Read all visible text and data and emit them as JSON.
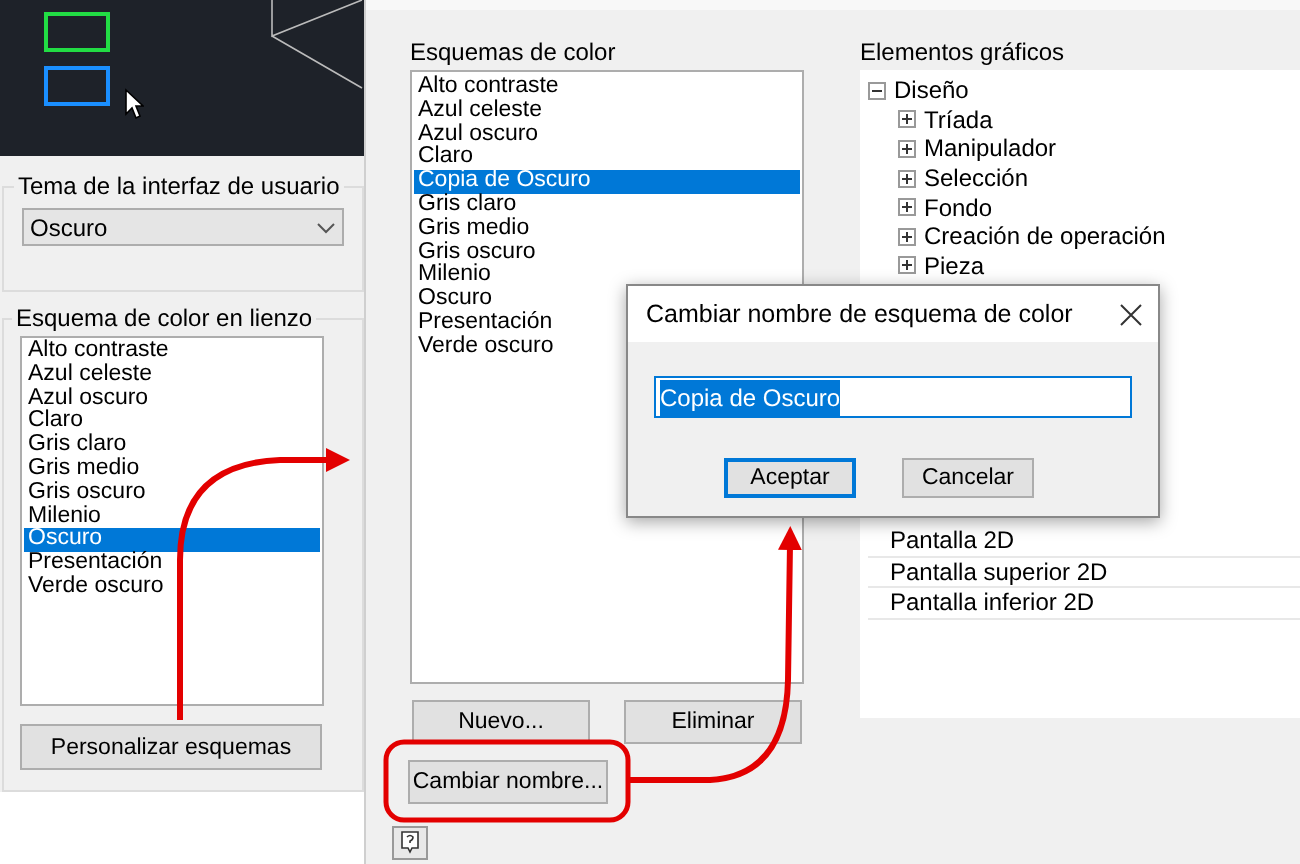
{
  "ui_theme": {
    "label": "Tema de la interfaz de usuario",
    "value": "Oscuro"
  },
  "canvas_scheme": {
    "label": "Esquema de color en lienzo",
    "items": [
      {
        "label": "Alto contraste",
        "selected": false
      },
      {
        "label": "Azul celeste",
        "selected": false
      },
      {
        "label": "Azul oscuro",
        "selected": false
      },
      {
        "label": "Claro",
        "selected": false
      },
      {
        "label": "Gris claro",
        "selected": false
      },
      {
        "label": "Gris medio",
        "selected": false
      },
      {
        "label": "Gris oscuro",
        "selected": false
      },
      {
        "label": "Milenio",
        "selected": false
      },
      {
        "label": "Oscuro",
        "selected": true
      },
      {
        "label": "Presentación",
        "selected": false
      },
      {
        "label": "Verde oscuro",
        "selected": false
      }
    ],
    "button": "Personalizar esquemas"
  },
  "schemes": {
    "label": "Esquemas de color",
    "items": [
      {
        "label": "Alto contraste",
        "selected": false
      },
      {
        "label": "Azul celeste",
        "selected": false
      },
      {
        "label": "Azul oscuro",
        "selected": false
      },
      {
        "label": "Claro",
        "selected": false
      },
      {
        "label": "Copia de Oscuro",
        "selected": true
      },
      {
        "label": "Gris claro",
        "selected": false
      },
      {
        "label": "Gris medio",
        "selected": false
      },
      {
        "label": "Gris oscuro",
        "selected": false
      },
      {
        "label": "Milenio",
        "selected": false
      },
      {
        "label": "Oscuro",
        "selected": false
      },
      {
        "label": "Presentación",
        "selected": false
      },
      {
        "label": "Verde oscuro",
        "selected": false
      }
    ],
    "buttons": [
      "Nuevo...",
      "Eliminar"
    ],
    "rename_button": "Cambiar nombre..."
  },
  "graphics": {
    "label": "Elementos gráficos",
    "tree": [
      {
        "label": "Diseño",
        "expanded": true,
        "children": [
          {
            "label": "Tríada",
            "expanded": false
          },
          {
            "label": "Manipulador",
            "expanded": false
          },
          {
            "label": "Selección",
            "expanded": false
          },
          {
            "label": "Fondo",
            "expanded": false
          },
          {
            "label": "Creación de operación",
            "expanded": false
          },
          {
            "label": "Pieza",
            "expanded": false
          }
        ]
      }
    ],
    "rows": [
      "Pantalla 2D",
      "Pantalla superior 2D",
      "Pantalla inferior 2D"
    ]
  },
  "rename_dialog": {
    "title": "Cambiar nombre de esquema de color",
    "value": "Copia de Oscuro",
    "text_selected": true,
    "buttons": [
      {
        "label": "Aceptar",
        "default": true
      },
      {
        "label": "Cancelar",
        "default": false
      }
    ]
  }
}
